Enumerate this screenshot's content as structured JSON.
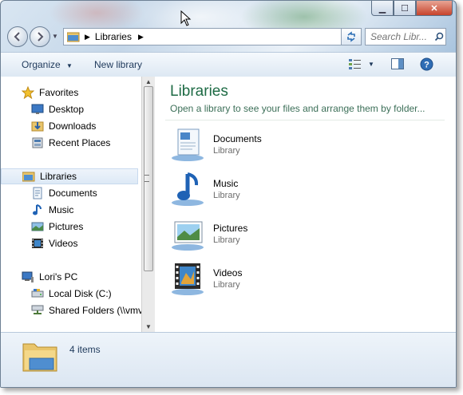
{
  "window": {
    "caption": {
      "minimize": "▁",
      "maximize": "☐",
      "close": "✕"
    }
  },
  "navigation": {
    "back_icon": "back-arrow-icon",
    "forward_icon": "forward-arrow-icon",
    "address_path": "Libraries",
    "search_placeholder": "Search Libr..."
  },
  "toolbar": {
    "organize_label": "Organize",
    "new_library_label": "New library"
  },
  "nav_pane": {
    "favorites": {
      "label": "Favorites",
      "items": [
        {
          "label": "Desktop",
          "icon": "desktop-icon"
        },
        {
          "label": "Downloads",
          "icon": "downloads-icon"
        },
        {
          "label": "Recent Places",
          "icon": "recent-places-icon"
        }
      ]
    },
    "libraries": {
      "label": "Libraries",
      "items": [
        {
          "label": "Documents",
          "icon": "documents-icon"
        },
        {
          "label": "Music",
          "icon": "music-icon"
        },
        {
          "label": "Pictures",
          "icon": "pictures-icon"
        },
        {
          "label": "Videos",
          "icon": "videos-icon"
        }
      ]
    },
    "computer": {
      "label": "Lori's PC",
      "items": [
        {
          "label": "Local Disk (C:)",
          "icon": "local-disk-icon"
        },
        {
          "label": "Shared Folders (\\\\vmv",
          "icon": "shared-folders-icon"
        }
      ]
    }
  },
  "main": {
    "title": "Libraries",
    "subtitle": "Open a library to see your files and arrange them by folder...",
    "libraries": [
      {
        "name": "Documents",
        "type": "Library",
        "icon": "documents-library-icon"
      },
      {
        "name": "Music",
        "type": "Library",
        "icon": "music-library-icon"
      },
      {
        "name": "Pictures",
        "type": "Library",
        "icon": "pictures-library-icon"
      },
      {
        "name": "Videos",
        "type": "Library",
        "icon": "videos-library-icon"
      }
    ]
  },
  "details_pane": {
    "count_text": "4 items"
  },
  "colors": {
    "title_green": "#1e6b45",
    "toolbar_text": "#1e395b"
  }
}
